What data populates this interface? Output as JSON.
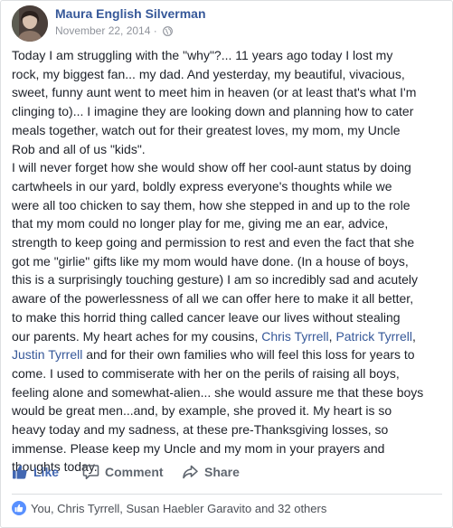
{
  "post": {
    "author": "Maura English Silverman",
    "date": "November 22, 2014",
    "date_separator": "·",
    "privacy_icon": "globe-icon",
    "body_segments": [
      {
        "text": "Today I am struggling with the \"why\"?... 11 years ago today I lost my\nrock, my biggest fan... my dad. And yesterday, my beautiful, vivacious,\nsweet, funny aunt went to meet him in heaven (or at least that's what I'm\nclinging to)... I imagine they are looking down and planning how to cater\nmeals together, watch out for their greatest loves, my mom, my Uncle\nRob and all of us \"kids\".\nI will never forget how she would show off her cool-aunt status by doing\ncartwheels in our yard, boldly express everyone's thoughts while we\nwere all too chicken to say them, how she stepped in and up to the role\nthat my mom could no longer play for me, giving me an ear, advice,\nstrength to keep going and permission to rest and even the fact that she\ngot me \"girlie\" gifts like my mom would have done. (In a house of boys,\nthis is a surprisingly touching gesture) I am so incredibly sad and acutely\naware of the powerlessness of all we can offer here to make it all better,\nto make this horrid thing called cancer leave our lives without stealing\nour parents. My heart aches for my cousins, ",
        "mention": false
      },
      {
        "text": "Chris Tyrrell",
        "mention": true
      },
      {
        "text": ", ",
        "mention": false
      },
      {
        "text": "Patrick Tyrrell",
        "mention": true
      },
      {
        "text": ",\n",
        "mention": false
      },
      {
        "text": "Justin Tyrrell",
        "mention": true
      },
      {
        "text": " and for their own families who will feel this loss for years to\ncome. I used to commiserate with her on the perils of raising all boys,\nfeeling alone and somewhat-alien... she would assure me that these boys\nwould be great men...and, by example, she proved it. My heart is so\nheavy today and my sadness, at these pre-Thanksgiving losses, so\nimmense. Please keep my Uncle and my mom in your prayers and\nthoughts today.",
        "mention": false
      }
    ]
  },
  "actions": {
    "like": {
      "label": "Like",
      "icon": "thumbs-up-icon",
      "color": "#4267b2"
    },
    "comment": {
      "label": "Comment",
      "icon": "comment-icon"
    },
    "share": {
      "label": "Share",
      "icon": "share-icon"
    }
  },
  "reactions": {
    "icon": "like-reaction-icon",
    "summary": "You, Chris Tyrrell, Susan Haebler Garavito and 32 others"
  },
  "colors": {
    "link": "#365899",
    "meta": "#90949c",
    "action": "#606770",
    "like_active": "#4267b2"
  }
}
